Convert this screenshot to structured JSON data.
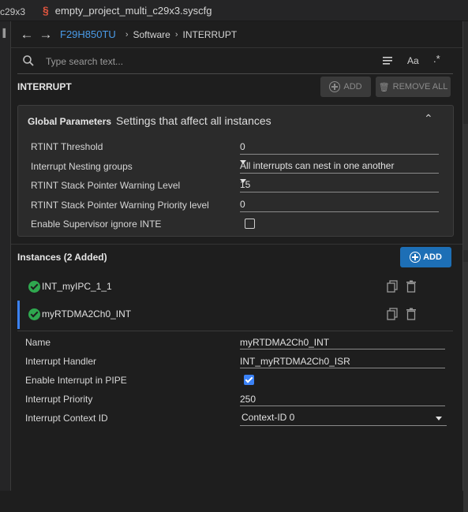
{
  "tabs": {
    "previous_tab": "c29x3",
    "active_tab": "empty_project_multi_c29x3.syscfg",
    "active_tab_icon": "syscfg-s-icon"
  },
  "breadcrumb": {
    "device": "F29H850TU",
    "items": [
      "Software",
      "INTERRUPT"
    ]
  },
  "search": {
    "placeholder": "Type search text...",
    "case_label": "Aa"
  },
  "section": {
    "title": "INTERRUPT",
    "add_label": "ADD",
    "remove_all_label": "REMOVE ALL"
  },
  "globals": {
    "title": "Global Parameters",
    "subtitle": "Settings that affect all instances",
    "params": [
      {
        "label": "RTINT Threshold",
        "value": "0"
      },
      {
        "label": "Interrupt Nesting groups",
        "value": "All interrupts can nest in one another"
      },
      {
        "label": "RTINT Stack Pointer Warning Level",
        "value": "15"
      },
      {
        "label": "RTINT Stack Pointer Warning Priority level",
        "value": "0"
      },
      {
        "label": "Enable Supervisor ignore INTE",
        "checked": false
      }
    ]
  },
  "instances": {
    "title": "Instances (2 Added)",
    "add_label": "ADD",
    "items": [
      {
        "name": "INT_myIPC_1_1",
        "selected": false
      },
      {
        "name": "myRTDMA2Ch0_INT",
        "selected": true
      }
    ]
  },
  "details": {
    "fields": [
      {
        "label": "Name",
        "value": "myRTDMA2Ch0_INT"
      },
      {
        "label": "Interrupt Handler",
        "value": "INT_myRTDMA2Ch0_ISR"
      },
      {
        "label": "Enable Interrupt in PIPE",
        "checked": true
      },
      {
        "label": "Interrupt Priority",
        "value": "250"
      },
      {
        "label": "Interrupt Context ID",
        "value": "Context-ID 0"
      }
    ]
  },
  "colors": {
    "accent": "#3b82f6",
    "device_link": "#4a9be8",
    "success": "#2fa84f",
    "syscfg_icon": "#e0553f",
    "primary_button": "#1d6fb6"
  }
}
